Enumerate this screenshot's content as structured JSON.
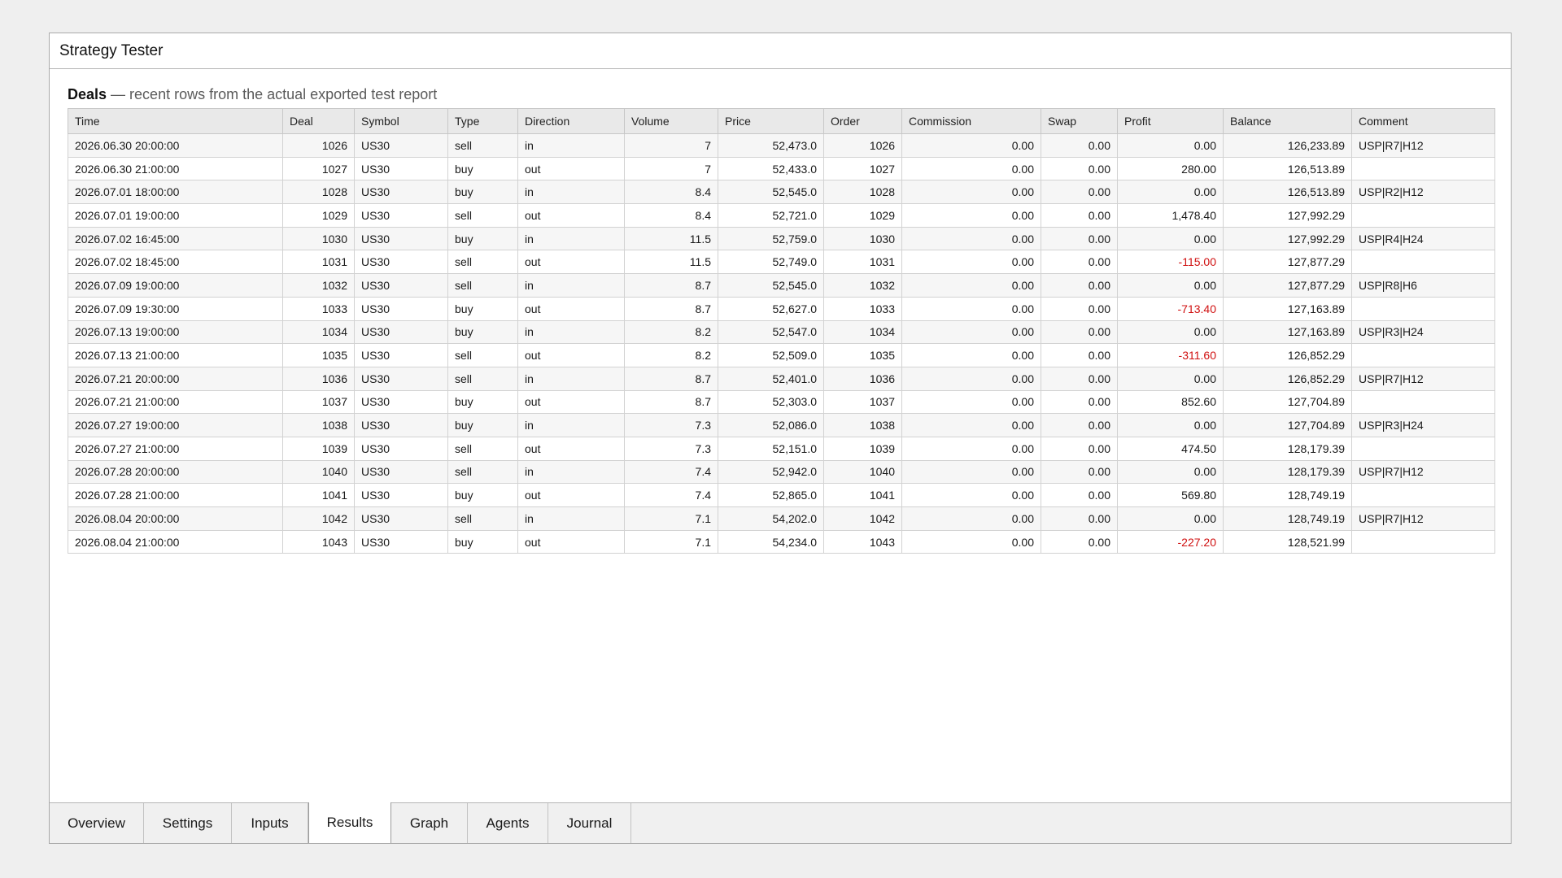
{
  "window": {
    "title": "Strategy Tester"
  },
  "section": {
    "title": "Deals",
    "subtitle": " — recent rows from the actual exported test report"
  },
  "table": {
    "columns": [
      "Time",
      "Deal",
      "Symbol",
      "Type",
      "Direction",
      "Volume",
      "Price",
      "Order",
      "Commission",
      "Swap",
      "Profit",
      "Balance",
      "Comment"
    ],
    "rows": [
      {
        "time": "2026.06.30 20:00:00",
        "deal": "1026",
        "symbol": "US30",
        "type": "sell",
        "direction": "in",
        "volume": "7",
        "price": "52,473.0",
        "order": "1026",
        "commission": "0.00",
        "swap": "0.00",
        "profit": "0.00",
        "balance": "126,233.89",
        "comment": "USP|R7|H12"
      },
      {
        "time": "2026.06.30 21:00:00",
        "deal": "1027",
        "symbol": "US30",
        "type": "buy",
        "direction": "out",
        "volume": "7",
        "price": "52,433.0",
        "order": "1027",
        "commission": "0.00",
        "swap": "0.00",
        "profit": "280.00",
        "balance": "126,513.89",
        "comment": ""
      },
      {
        "time": "2026.07.01 18:00:00",
        "deal": "1028",
        "symbol": "US30",
        "type": "buy",
        "direction": "in",
        "volume": "8.4",
        "price": "52,545.0",
        "order": "1028",
        "commission": "0.00",
        "swap": "0.00",
        "profit": "0.00",
        "balance": "126,513.89",
        "comment": "USP|R2|H12"
      },
      {
        "time": "2026.07.01 19:00:00",
        "deal": "1029",
        "symbol": "US30",
        "type": "sell",
        "direction": "out",
        "volume": "8.4",
        "price": "52,721.0",
        "order": "1029",
        "commission": "0.00",
        "swap": "0.00",
        "profit": "1,478.40",
        "balance": "127,992.29",
        "comment": ""
      },
      {
        "time": "2026.07.02 16:45:00",
        "deal": "1030",
        "symbol": "US30",
        "type": "buy",
        "direction": "in",
        "volume": "11.5",
        "price": "52,759.0",
        "order": "1030",
        "commission": "0.00",
        "swap": "0.00",
        "profit": "0.00",
        "balance": "127,992.29",
        "comment": "USP|R4|H24"
      },
      {
        "time": "2026.07.02 18:45:00",
        "deal": "1031",
        "symbol": "US30",
        "type": "sell",
        "direction": "out",
        "volume": "11.5",
        "price": "52,749.0",
        "order": "1031",
        "commission": "0.00",
        "swap": "0.00",
        "profit": "-115.00",
        "balance": "127,877.29",
        "comment": ""
      },
      {
        "time": "2026.07.09 19:00:00",
        "deal": "1032",
        "symbol": "US30",
        "type": "sell",
        "direction": "in",
        "volume": "8.7",
        "price": "52,545.0",
        "order": "1032",
        "commission": "0.00",
        "swap": "0.00",
        "profit": "0.00",
        "balance": "127,877.29",
        "comment": "USP|R8|H6"
      },
      {
        "time": "2026.07.09 19:30:00",
        "deal": "1033",
        "symbol": "US30",
        "type": "buy",
        "direction": "out",
        "volume": "8.7",
        "price": "52,627.0",
        "order": "1033",
        "commission": "0.00",
        "swap": "0.00",
        "profit": "-713.40",
        "balance": "127,163.89",
        "comment": ""
      },
      {
        "time": "2026.07.13 19:00:00",
        "deal": "1034",
        "symbol": "US30",
        "type": "buy",
        "direction": "in",
        "volume": "8.2",
        "price": "52,547.0",
        "order": "1034",
        "commission": "0.00",
        "swap": "0.00",
        "profit": "0.00",
        "balance": "127,163.89",
        "comment": "USP|R3|H24"
      },
      {
        "time": "2026.07.13 21:00:00",
        "deal": "1035",
        "symbol": "US30",
        "type": "sell",
        "direction": "out",
        "volume": "8.2",
        "price": "52,509.0",
        "order": "1035",
        "commission": "0.00",
        "swap": "0.00",
        "profit": "-311.60",
        "balance": "126,852.29",
        "comment": ""
      },
      {
        "time": "2026.07.21 20:00:00",
        "deal": "1036",
        "symbol": "US30",
        "type": "sell",
        "direction": "in",
        "volume": "8.7",
        "price": "52,401.0",
        "order": "1036",
        "commission": "0.00",
        "swap": "0.00",
        "profit": "0.00",
        "balance": "126,852.29",
        "comment": "USP|R7|H12"
      },
      {
        "time": "2026.07.21 21:00:00",
        "deal": "1037",
        "symbol": "US30",
        "type": "buy",
        "direction": "out",
        "volume": "8.7",
        "price": "52,303.0",
        "order": "1037",
        "commission": "0.00",
        "swap": "0.00",
        "profit": "852.60",
        "balance": "127,704.89",
        "comment": ""
      },
      {
        "time": "2026.07.27 19:00:00",
        "deal": "1038",
        "symbol": "US30",
        "type": "buy",
        "direction": "in",
        "volume": "7.3",
        "price": "52,086.0",
        "order": "1038",
        "commission": "0.00",
        "swap": "0.00",
        "profit": "0.00",
        "balance": "127,704.89",
        "comment": "USP|R3|H24"
      },
      {
        "time": "2026.07.27 21:00:00",
        "deal": "1039",
        "symbol": "US30",
        "type": "sell",
        "direction": "out",
        "volume": "7.3",
        "price": "52,151.0",
        "order": "1039",
        "commission": "0.00",
        "swap": "0.00",
        "profit": "474.50",
        "balance": "128,179.39",
        "comment": ""
      },
      {
        "time": "2026.07.28 20:00:00",
        "deal": "1040",
        "symbol": "US30",
        "type": "sell",
        "direction": "in",
        "volume": "7.4",
        "price": "52,942.0",
        "order": "1040",
        "commission": "0.00",
        "swap": "0.00",
        "profit": "0.00",
        "balance": "128,179.39",
        "comment": "USP|R7|H12"
      },
      {
        "time": "2026.07.28 21:00:00",
        "deal": "1041",
        "symbol": "US30",
        "type": "buy",
        "direction": "out",
        "volume": "7.4",
        "price": "52,865.0",
        "order": "1041",
        "commission": "0.00",
        "swap": "0.00",
        "profit": "569.80",
        "balance": "128,749.19",
        "comment": ""
      },
      {
        "time": "2026.08.04 20:00:00",
        "deal": "1042",
        "symbol": "US30",
        "type": "sell",
        "direction": "in",
        "volume": "7.1",
        "price": "54,202.0",
        "order": "1042",
        "commission": "0.00",
        "swap": "0.00",
        "profit": "0.00",
        "balance": "128,749.19",
        "comment": "USP|R7|H12"
      },
      {
        "time": "2026.08.04 21:00:00",
        "deal": "1043",
        "symbol": "US30",
        "type": "buy",
        "direction": "out",
        "volume": "7.1",
        "price": "54,234.0",
        "order": "1043",
        "commission": "0.00",
        "swap": "0.00",
        "profit": "-227.20",
        "balance": "128,521.99",
        "comment": ""
      }
    ]
  },
  "tabs": [
    {
      "label": "Overview",
      "active": false
    },
    {
      "label": "Settings",
      "active": false
    },
    {
      "label": "Inputs",
      "active": false
    },
    {
      "label": "Results",
      "active": true
    },
    {
      "label": "Graph",
      "active": false
    },
    {
      "label": "Agents",
      "active": false
    },
    {
      "label": "Journal",
      "active": false
    }
  ],
  "colors": {
    "negative_profit": "#d01010",
    "header_bg": "#e9e9e9",
    "odd_row_bg": "#f6f6f6"
  }
}
